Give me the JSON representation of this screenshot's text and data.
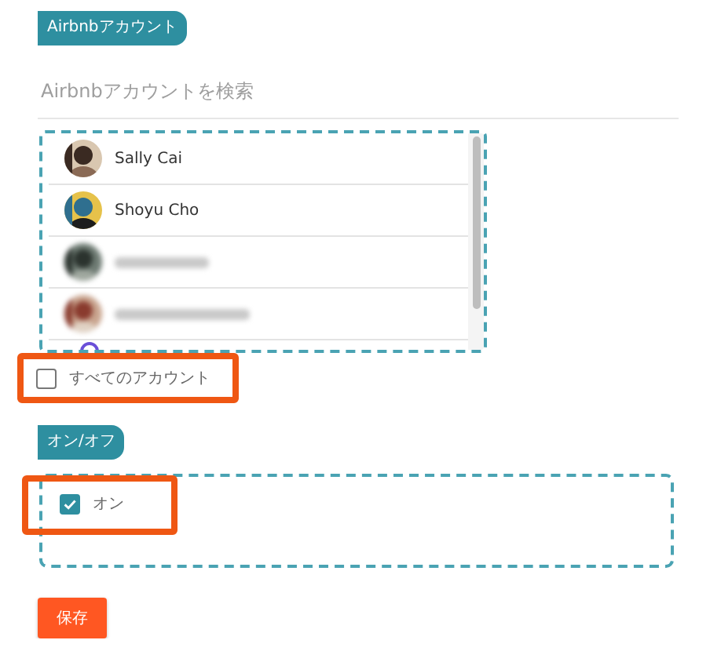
{
  "account_section": {
    "tag": "Airbnbアカウント",
    "search": {
      "placeholder": "Airbnbアカウントを検索"
    },
    "accounts": [
      {
        "name": "Sally Cai",
        "blurred": false
      },
      {
        "name": "Shoyu Cho",
        "blurred": false
      },
      {
        "blurred": true
      },
      {
        "blurred": true
      }
    ],
    "all_accounts": {
      "label": "すべてのアカウント",
      "checked": false,
      "highlighted": true
    }
  },
  "onoff_section": {
    "tag": "オン/オフ",
    "option": {
      "label": "オン",
      "checked": true,
      "highlighted": true
    }
  },
  "save_button": "保存"
}
